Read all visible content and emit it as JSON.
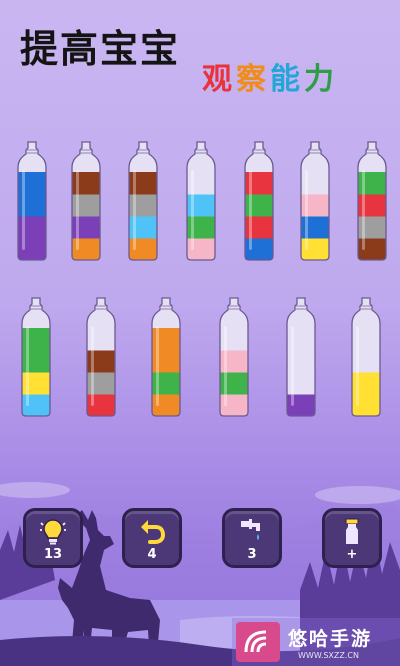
{
  "title": {
    "line1": "提高宝宝",
    "line2": [
      "观",
      "察",
      "能",
      "力"
    ]
  },
  "bottles_row1": [
    {
      "layers": [
        "#7b3fb8",
        "#7b3fb8",
        "#1e6fd6",
        "#1e6fd6"
      ]
    },
    {
      "layers": [
        "#f08a24",
        "#7b3fb8",
        "#9e9e9e",
        "#8b3a1a"
      ]
    },
    {
      "layers": [
        "#f08a24",
        "#4fc3f7",
        "#9e9e9e",
        "#8b3a1a"
      ]
    },
    {
      "layers": [
        "#f7b6c8",
        "#3db34a",
        "#4fc3f7",
        "#e6e0f4"
      ]
    },
    {
      "layers": [
        "#1e6fd6",
        "#e8343e",
        "#3db34a",
        "#e8343e"
      ]
    },
    {
      "layers": [
        "#ffe033",
        "#1e6fd6",
        "#f7b6c8",
        "#e6e0f4"
      ]
    },
    {
      "layers": [
        "#8b3a1a",
        "#9e9e9e",
        "#e8343e",
        "#3db34a"
      ]
    }
  ],
  "bottles_row2": [
    {
      "layers": [
        "#4fc3f7",
        "#ffe033",
        "#3db34a",
        "#3db34a"
      ]
    },
    {
      "layers": [
        "#e8343e",
        "#9e9e9e",
        "#8b3a1a",
        "#e6e0f4"
      ]
    },
    {
      "layers": [
        "#f08a24",
        "#3db34a",
        "#f08a24",
        "#f08a24"
      ]
    },
    {
      "layers": [
        "#f7b6c8",
        "#3db34a",
        "#f7b6c8",
        "#e6e0f4"
      ]
    },
    {
      "layers": [
        "#7b3fb8",
        "#e6e0f4",
        "#e6e0f4",
        "#e6e0f4"
      ]
    },
    {
      "layers": [
        "#ffe033",
        "#ffe033",
        "#e6e0f4",
        "#e6e0f4"
      ]
    }
  ],
  "buttons": {
    "hint": {
      "icon": "lightbulb-icon",
      "count": "13"
    },
    "undo": {
      "icon": "undo-arrow-icon",
      "count": "4"
    },
    "tap": {
      "icon": "faucet-icon",
      "count": "3"
    },
    "add_bottle": {
      "icon": "add-bottle-icon",
      "count": "+"
    }
  },
  "watermark": {
    "text": "悠哈手游",
    "sub": "WWW.SXZZ.CN"
  }
}
